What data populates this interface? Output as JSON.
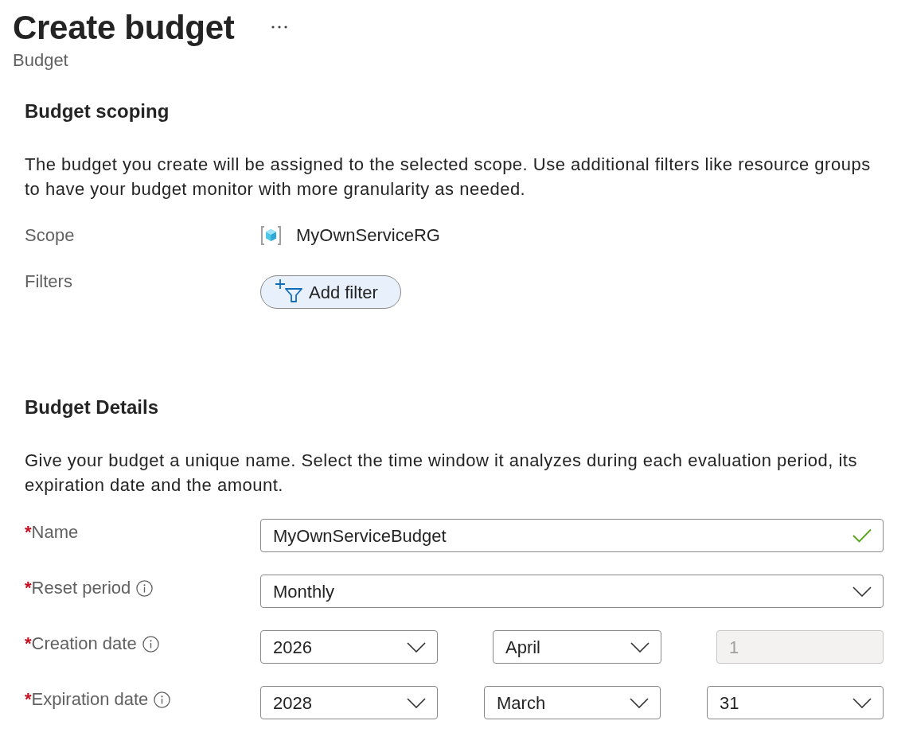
{
  "header": {
    "title": "Create budget",
    "subtitle": "Budget"
  },
  "sections": [
    {
      "heading": "Budget scoping",
      "description": "The budget you create will be assigned to the selected scope. Use additional filters like resource groups to have your budget monitor with more granularity as needed.",
      "fields": [
        {
          "kind": "scope",
          "label": "Scope",
          "info": false,
          "value": "MyOwnServiceRG"
        },
        {
          "kind": "button",
          "label": "Filters",
          "info": false,
          "value": "Add filter"
        }
      ]
    },
    {
      "heading": "Budget Details",
      "description": "Give your budget a unique name. Select the time window it analyzes during each evaluation period, its expiration date and the amount.",
      "fields": [
        {
          "kind": "text",
          "required_mark": "*",
          "label": "Name",
          "info": false,
          "value": "MyOwnServiceBudget",
          "valid": true
        },
        {
          "kind": "select",
          "required_mark": "*",
          "label": "Reset period",
          "info": true,
          "value": "Monthly"
        },
        {
          "kind": "date",
          "required_mark": "*",
          "label": "Creation date",
          "info": true,
          "parts": [
            {
              "value": "2026",
              "disabled": false
            },
            {
              "value": "April",
              "disabled": false
            },
            {
              "value": "1",
              "disabled": true
            }
          ]
        },
        {
          "kind": "date",
          "required_mark": "*",
          "label": "Expiration date",
          "info": true,
          "parts": [
            {
              "value": "2028",
              "disabled": false
            },
            {
              "value": "March",
              "disabled": false
            },
            {
              "value": "31",
              "disabled": false
            }
          ]
        }
      ]
    }
  ]
}
